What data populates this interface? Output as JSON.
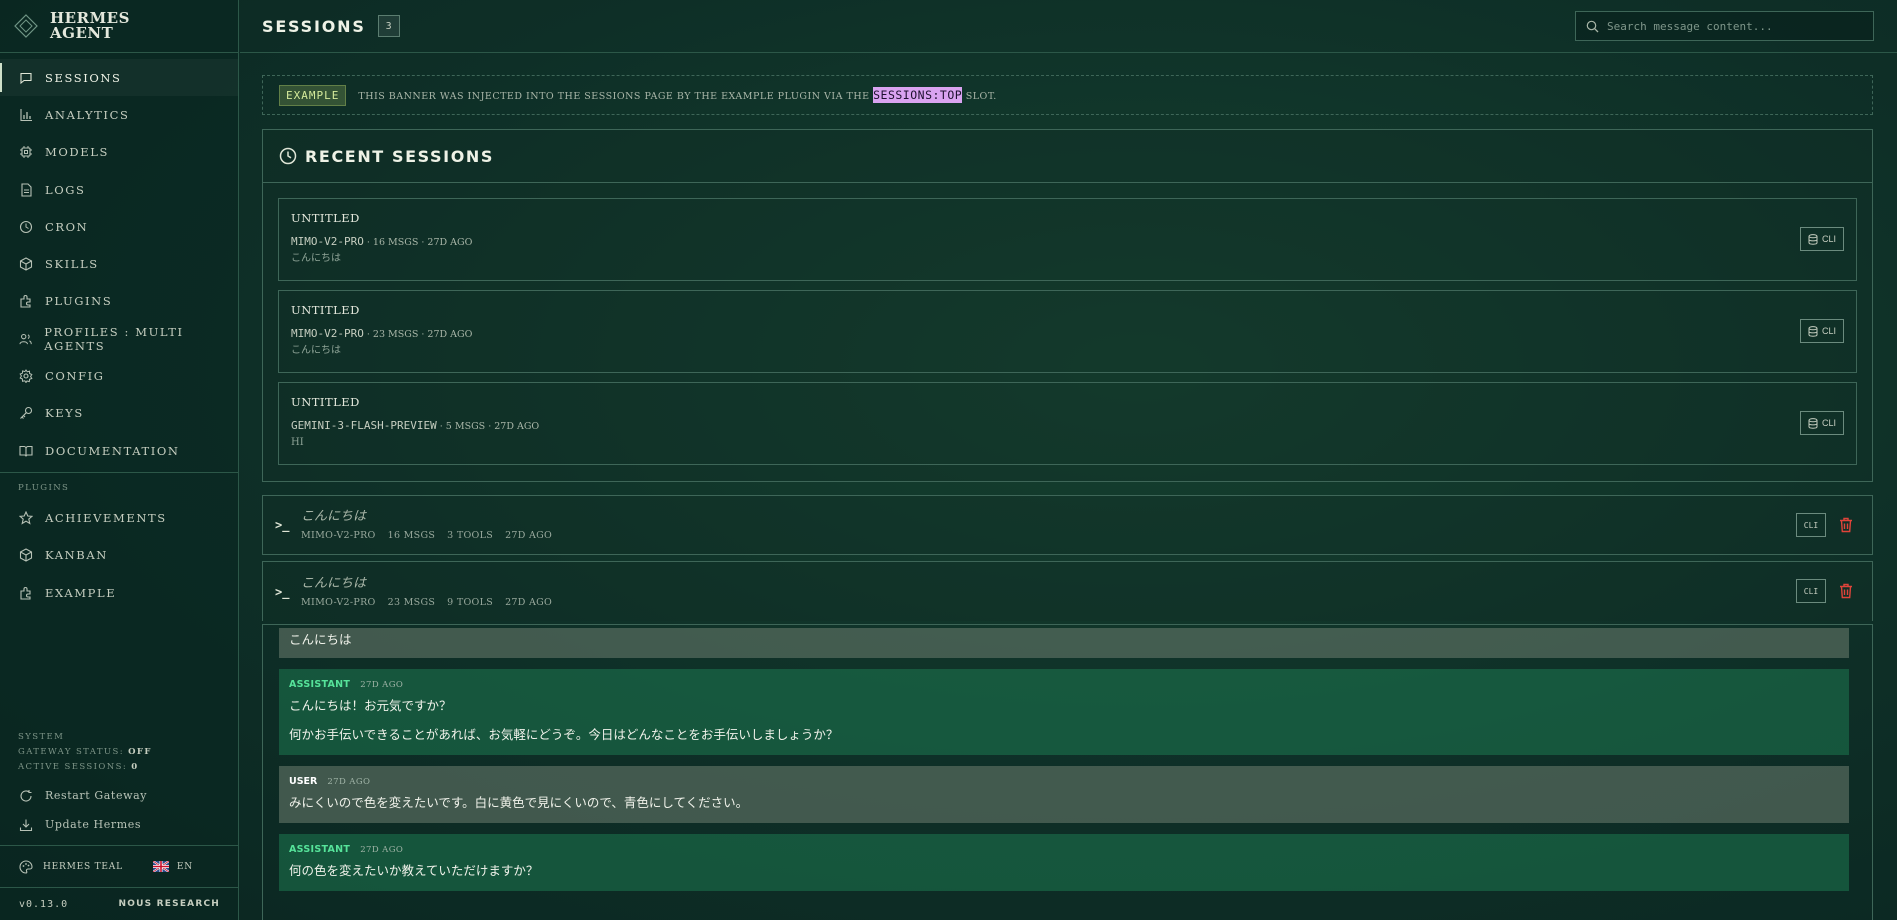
{
  "brand": {
    "line1": "HERMES",
    "line2": "AGENT"
  },
  "nav": [
    {
      "label": "SESSIONS",
      "icon": "chat-icon",
      "active": true
    },
    {
      "label": "ANALYTICS",
      "icon": "bar-chart-icon"
    },
    {
      "label": "MODELS",
      "icon": "chip-icon"
    },
    {
      "label": "LOGS",
      "icon": "document-icon"
    },
    {
      "label": "CRON",
      "icon": "clock-icon"
    },
    {
      "label": "SKILLS",
      "icon": "cube-icon"
    },
    {
      "label": "PLUGINS",
      "icon": "puzzle-icon"
    },
    {
      "label": "PROFILES : MULTI AGENTS",
      "icon": "users-icon"
    },
    {
      "label": "CONFIG",
      "icon": "gear-icon"
    },
    {
      "label": "KEYS",
      "icon": "key-icon"
    },
    {
      "label": "DOCUMENTATION",
      "icon": "book-icon"
    }
  ],
  "plugins_section": {
    "label": "PLUGINS",
    "items": [
      {
        "label": "ACHIEVEMENTS",
        "icon": "star-icon"
      },
      {
        "label": "KANBAN",
        "icon": "cube-icon"
      },
      {
        "label": "EXAMPLE",
        "icon": "puzzle-icon"
      }
    ]
  },
  "system": {
    "label": "SYSTEM",
    "gateway_label": "GATEWAY STATUS:",
    "gateway_value": "OFF",
    "active_label": "ACTIVE SESSIONS:",
    "active_value": "0",
    "restart": "Restart Gateway",
    "update": "Update Hermes"
  },
  "footer": {
    "theme": "HERMES TEAL",
    "lang": "EN",
    "version": "v0.13.0",
    "org": "NOUS RESEARCH"
  },
  "header": {
    "title": "SESSIONS",
    "count": "3",
    "search_placeholder": "Search message content..."
  },
  "banner": {
    "tag": "EXAMPLE",
    "text_before": "THIS BANNER WAS INJECTED INTO THE SESSIONS PAGE BY THE EXAMPLE PLUGIN VIA THE",
    "highlight": "SESSIONS:TOP",
    "text_after": "SLOT."
  },
  "recent": {
    "title": "RECENT SESSIONS",
    "items": [
      {
        "title": "UNTITLED",
        "model": "MIMO-V2-PRO",
        "meta": "· 16 MSGS · 27D AGO",
        "preview": "こんにちは",
        "button": "CLI"
      },
      {
        "title": "UNTITLED",
        "model": "MIMO-V2-PRO",
        "meta": "· 23 MSGS · 27D AGO",
        "preview": "こんにちは",
        "button": "CLI"
      },
      {
        "title": "UNTITLED",
        "model": "GEMINI-3-FLASH-PREVIEW",
        "meta": "· 5 MSGS · 27D AGO",
        "preview": "HI",
        "button": "CLI"
      }
    ]
  },
  "sessions": [
    {
      "title": "こんにちは",
      "model": "MIMO-V2-PRO",
      "msgs": "16 MSGS",
      "tools": "3 TOOLS",
      "ago": "27D AGO",
      "button": "CLI"
    },
    {
      "title": "こんにちは",
      "model": "MIMO-V2-PRO",
      "msgs": "23 MSGS",
      "tools": "9 TOOLS",
      "ago": "27D AGO",
      "button": "CLI"
    }
  ],
  "messages": {
    "m0": {
      "text": "こんにちは"
    },
    "m1": {
      "role": "ASSISTANT",
      "time": "27D AGO",
      "p1": "こんにちは！お元気ですか？",
      "p2": "何かお手伝いできることがあれば、お気軽にどうぞ。今日はどんなことをお手伝いしましょうか？"
    },
    "m2": {
      "role": "USER",
      "time": "27D AGO",
      "p1": "みにくいので色を変えたいです。白に黄色で見にくいので、青色にしてください。"
    },
    "m3": {
      "role": "ASSISTANT",
      "time": "27D AGO",
      "p1": "何の色を変えたいか教えていただけますか？"
    }
  },
  "colors": {
    "accent_green": "#56e39a",
    "highlight": "#d9a3f0",
    "danger": "#e0443a",
    "background": "#0f3329"
  }
}
